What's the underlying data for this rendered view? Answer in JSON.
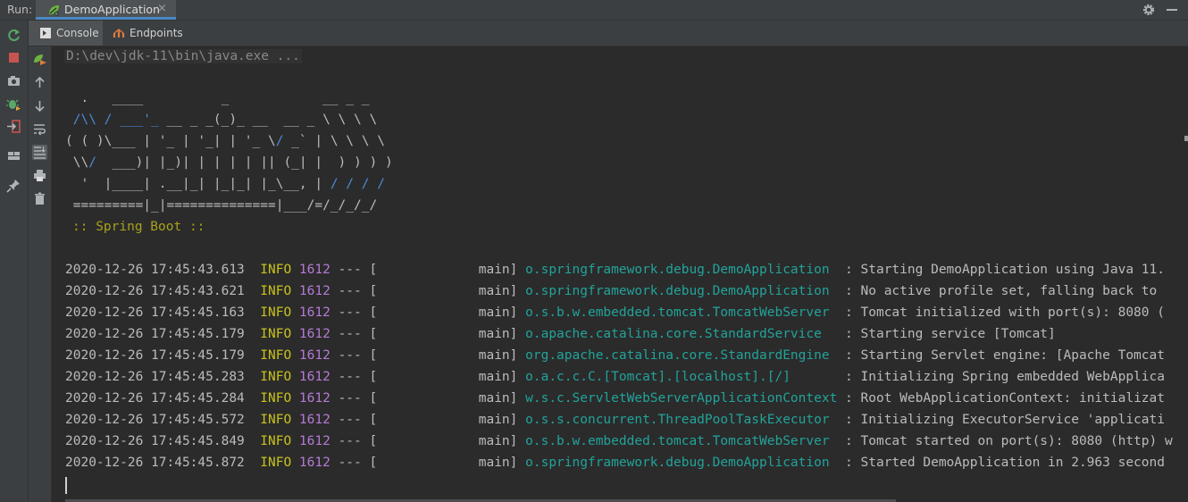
{
  "runbar": {
    "label": "Run:",
    "tab_title": "DemoApplication",
    "close": "×"
  },
  "subtabs": {
    "console": "Console",
    "endpoints": "Endpoints"
  },
  "console": {
    "command": "D:\\dev\\jdk-11\\bin\\java.exe ...",
    "spring_boot_label": ":: Spring Boot ::",
    "logs": [
      {
        "ts": "2020-12-26 17:45:43.613",
        "level": "INFO",
        "pid": "1612",
        "sep": "--- [",
        "thread": "main]",
        "logger": "o.springframework.debug.DemoApplication",
        "msg": "Starting DemoApplication using Java 11."
      },
      {
        "ts": "2020-12-26 17:45:43.621",
        "level": "INFO",
        "pid": "1612",
        "sep": "--- [",
        "thread": "main]",
        "logger": "o.springframework.debug.DemoApplication",
        "msg": "No active profile set, falling back to"
      },
      {
        "ts": "2020-12-26 17:45:45.163",
        "level": "INFO",
        "pid": "1612",
        "sep": "--- [",
        "thread": "main]",
        "logger": "o.s.b.w.embedded.tomcat.TomcatWebServer",
        "msg": "Tomcat initialized with port(s): 8080 ("
      },
      {
        "ts": "2020-12-26 17:45:45.179",
        "level": "INFO",
        "pid": "1612",
        "sep": "--- [",
        "thread": "main]",
        "logger": "o.apache.catalina.core.StandardService",
        "msg": "Starting service [Tomcat]"
      },
      {
        "ts": "2020-12-26 17:45:45.179",
        "level": "INFO",
        "pid": "1612",
        "sep": "--- [",
        "thread": "main]",
        "logger": "org.apache.catalina.core.StandardEngine",
        "msg": "Starting Servlet engine: [Apache Tomcat"
      },
      {
        "ts": "2020-12-26 17:45:45.283",
        "level": "INFO",
        "pid": "1612",
        "sep": "--- [",
        "thread": "main]",
        "logger": "o.a.c.c.C.[Tomcat].[localhost].[/]",
        "msg": "Initializing Spring embedded WebApplica"
      },
      {
        "ts": "2020-12-26 17:45:45.284",
        "level": "INFO",
        "pid": "1612",
        "sep": "--- [",
        "thread": "main]",
        "logger": "w.s.c.ServletWebServerApplicationContext",
        "msg": "Root WebApplicationContext: initializat"
      },
      {
        "ts": "2020-12-26 17:45:45.572",
        "level": "INFO",
        "pid": "1612",
        "sep": "--- [",
        "thread": "main]",
        "logger": "o.s.s.concurrent.ThreadPoolTaskExecutor",
        "msg": "Initializing ExecutorService 'applicati"
      },
      {
        "ts": "2020-12-26 17:45:45.849",
        "level": "INFO",
        "pid": "1612",
        "sep": "--- [",
        "thread": "main]",
        "logger": "o.s.b.w.embedded.tomcat.TomcatWebServer",
        "msg": "Tomcat started on port(s): 8080 (http) w"
      },
      {
        "ts": "2020-12-26 17:45:45.872",
        "level": "INFO",
        "pid": "1612",
        "sep": "--- [",
        "thread": "main]",
        "logger": "o.springframework.debug.DemoApplication",
        "msg": "Started DemoApplication in 2.963 second"
      }
    ]
  },
  "colors": {
    "background": "#2b2b2b",
    "panel": "#3c3f41",
    "info": "#c7c21f",
    "pid": "#b57ad6",
    "logger": "#22a39a",
    "banner_accent": "#4b8bd6",
    "spring_boot": "#a8a21a",
    "tab_underline": "#4a88c7"
  },
  "icons": {
    "run_tab": "spring-leaf-icon",
    "settings": "gear-icon",
    "hide": "minimize-icon",
    "rerun": "rerun-icon",
    "stop": "stop-icon",
    "snapshot": "camera-icon",
    "debug": "debug-icon",
    "exit": "exit-icon",
    "layout": "layout-icon",
    "pin": "pin-icon",
    "console": "console-icon",
    "endpoints": "endpoints-icon",
    "scroll_up": "arrow-up-icon",
    "scroll_down": "arrow-down-icon",
    "soft_wrap": "soft-wrap-icon",
    "scroll_to_end": "scroll-to-end-icon",
    "print": "print-icon",
    "clear": "trash-icon"
  }
}
